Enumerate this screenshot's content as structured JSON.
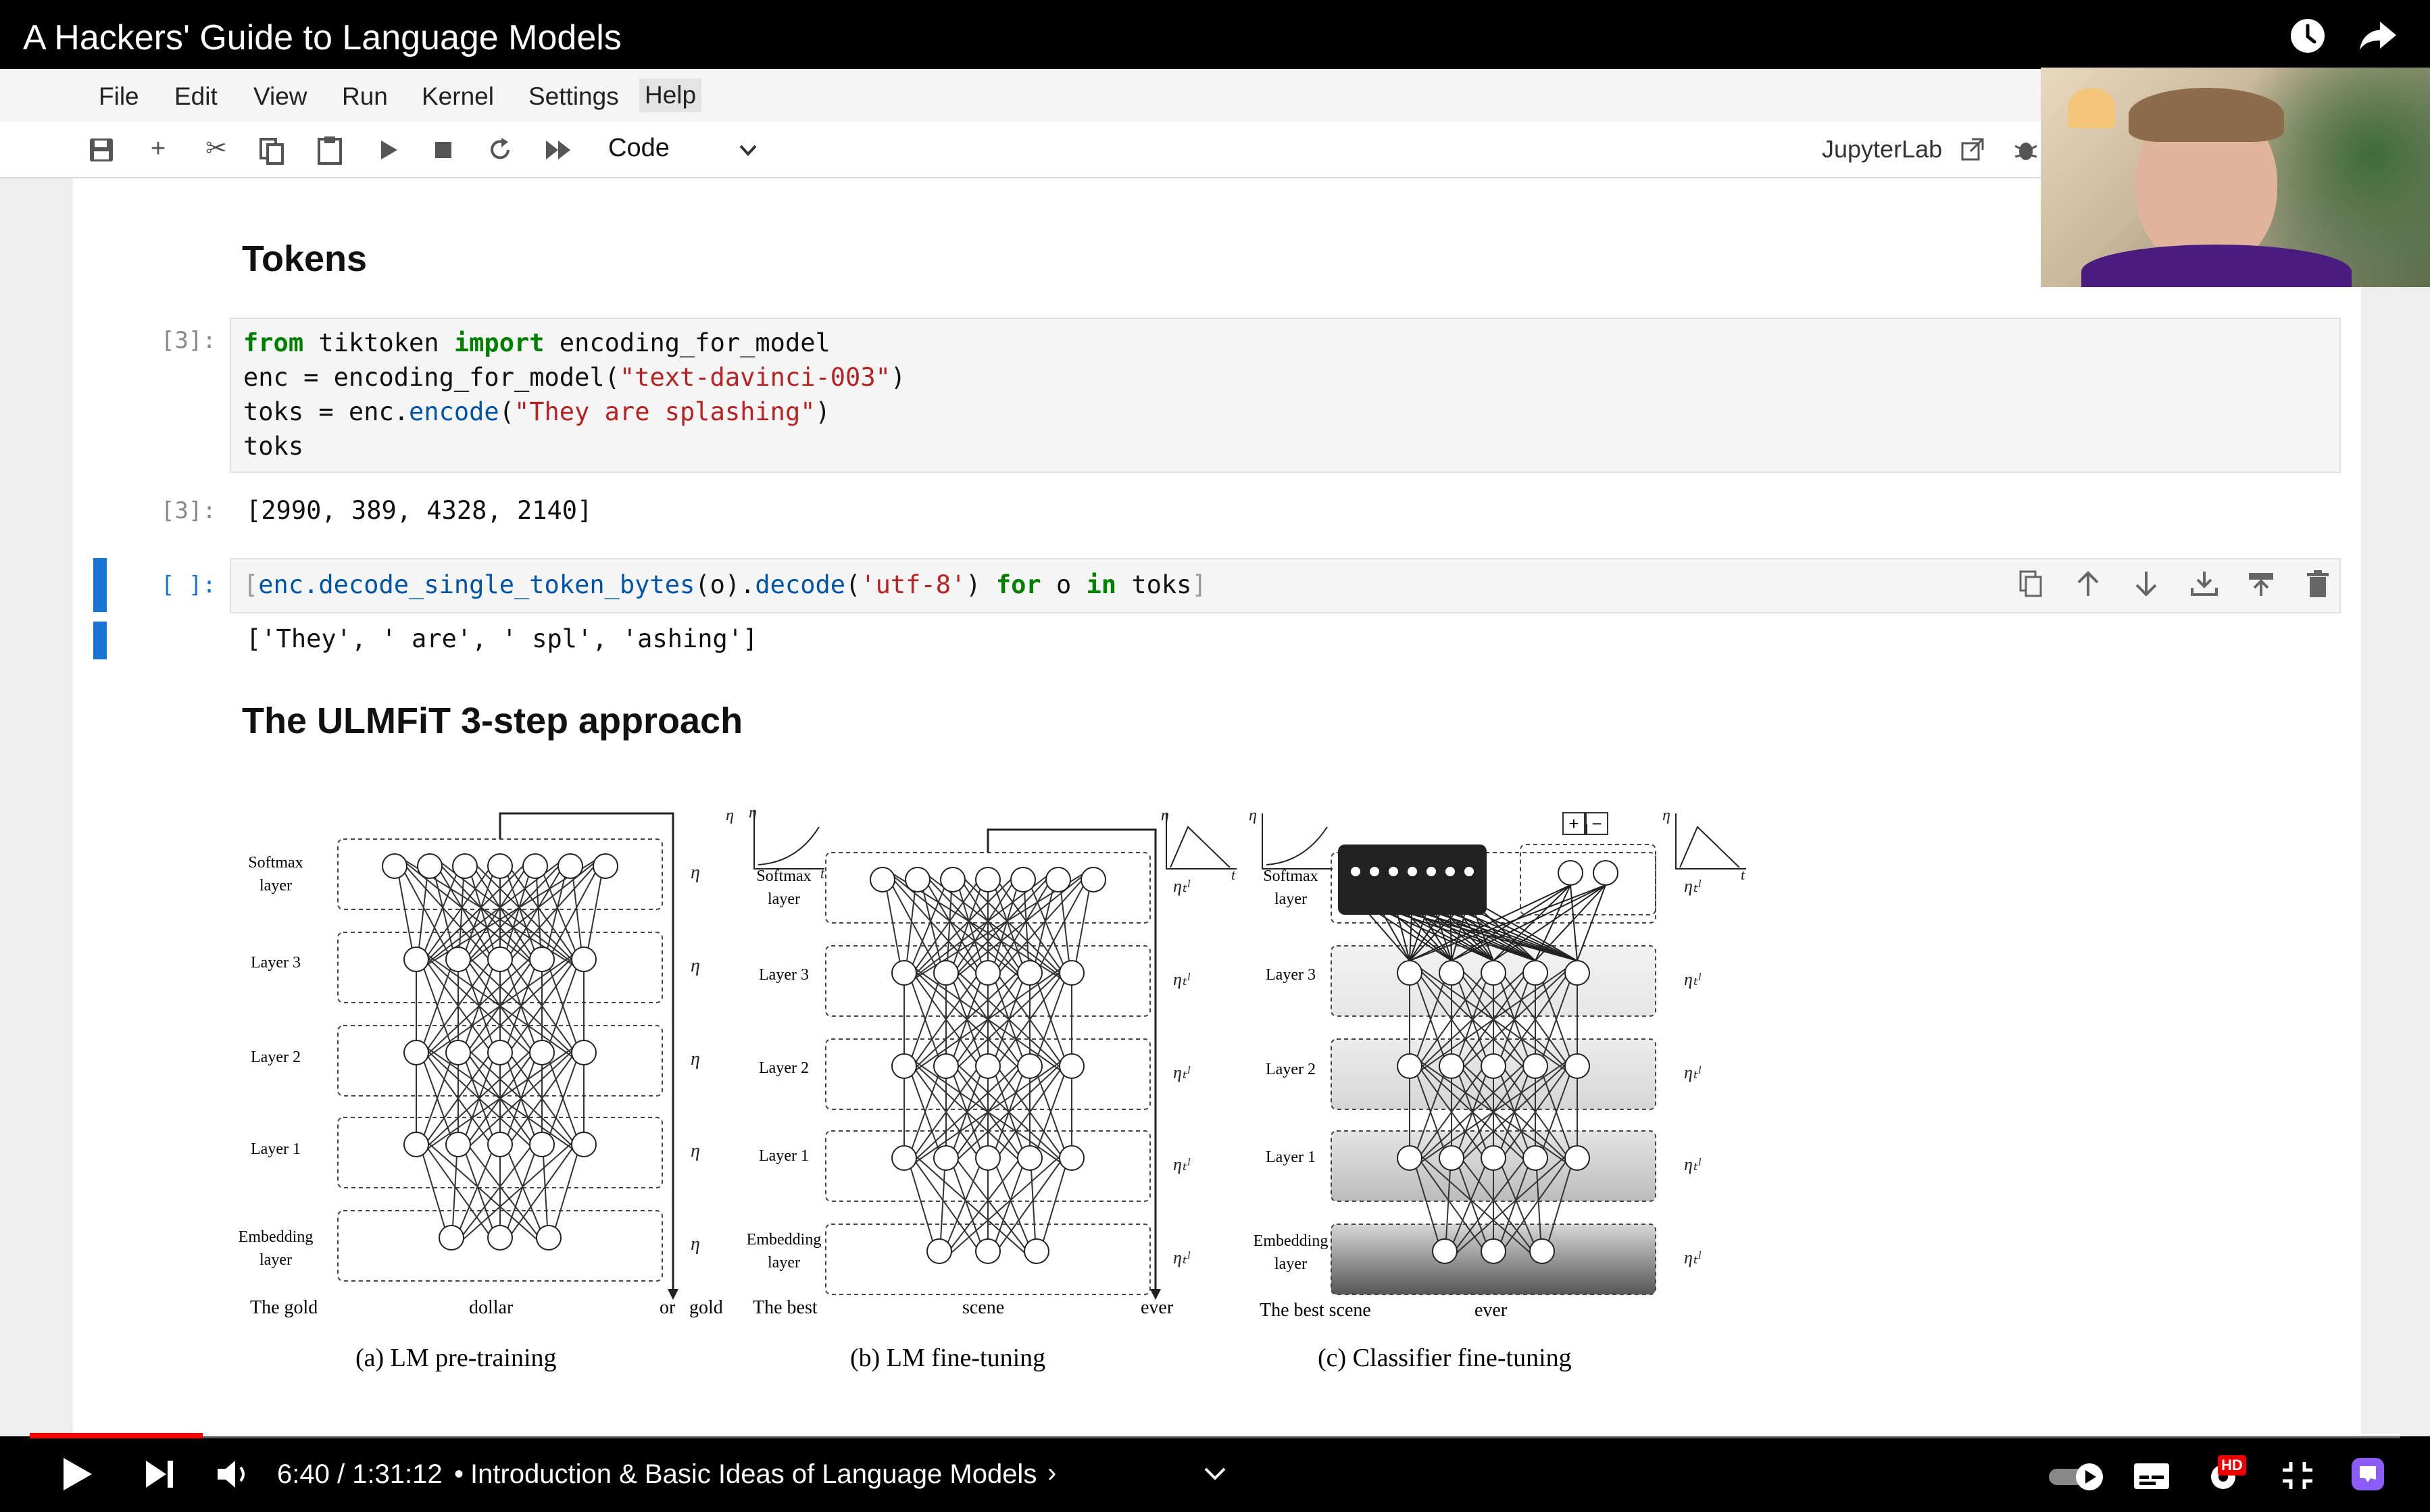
{
  "video": {
    "title": "A Hackers' Guide to Language Models",
    "time": "6:40 / 1:31:12",
    "separator": "•",
    "chapter": "Introduction & Basic Ideas of Language Models",
    "chapter_arrow": "›",
    "progress_fraction": 0.073,
    "hd_badge": "HD"
  },
  "menu": [
    "File",
    "Edit",
    "View",
    "Run",
    "Kernel",
    "Settings",
    "Help"
  ],
  "toolbar": {
    "cell_type": "Code",
    "jupyterlab_label": "JupyterLab",
    "icons": [
      "save-icon",
      "add-icon",
      "cut-icon",
      "copy-icon",
      "paste-icon",
      "run-icon",
      "stop-icon",
      "restart-icon",
      "fast-forward-icon"
    ]
  },
  "notebook": {
    "heading_tokens": "Tokens",
    "cell1": {
      "prompt": "[3]:",
      "lines": [
        [
          "from",
          " tiktoken ",
          "import",
          " encoding_for_model"
        ],
        [
          "enc = encoding_for_model(",
          "\"text-davinci-003\"",
          ")"
        ],
        [
          "toks = enc.",
          "encode",
          "(",
          "\"They are splashing\"",
          ")"
        ],
        [
          "toks"
        ]
      ],
      "output_prompt": "[3]:",
      "output": "[2990, 389, 4328, 2140]"
    },
    "cell2": {
      "prompt": "[ ]:",
      "code": [
        "[",
        "enc.decode_single_token_bytes",
        "(o).",
        "decode",
        "(",
        "'utf-8'",
        ") ",
        "for",
        " o ",
        "in",
        " toks",
        "]"
      ],
      "output": "['They', ' are', ' spl', 'ashing']"
    },
    "heading_ulmfit": "The ULMFiT 3-step approach"
  },
  "figure": {
    "layers": [
      "Softmax layer",
      "Layer 3",
      "Layer 2",
      "Layer 1",
      "Embedding layer"
    ],
    "layer_lines": [
      [
        "Softmax",
        "layer"
      ],
      [
        "Layer 3"
      ],
      [
        "Layer 2"
      ],
      [
        "Layer 1"
      ],
      [
        "Embedding",
        "layer"
      ]
    ],
    "lr_symbol": "η",
    "lr_symbol_layered": "ηₜˡ",
    "time_symbol": "t",
    "panel_a": {
      "caption": "(a) LM pre-training",
      "words": [
        "The gold",
        "dollar",
        "or",
        "gold"
      ]
    },
    "panel_b": {
      "caption": "(b) LM fine-tuning",
      "words": [
        "The best",
        "scene",
        "ever"
      ]
    },
    "panel_c": {
      "caption": "(c) Classifier fine-tuning",
      "words": [
        "The best scene",
        "ever"
      ],
      "plus": "+",
      "minus": "−"
    }
  }
}
